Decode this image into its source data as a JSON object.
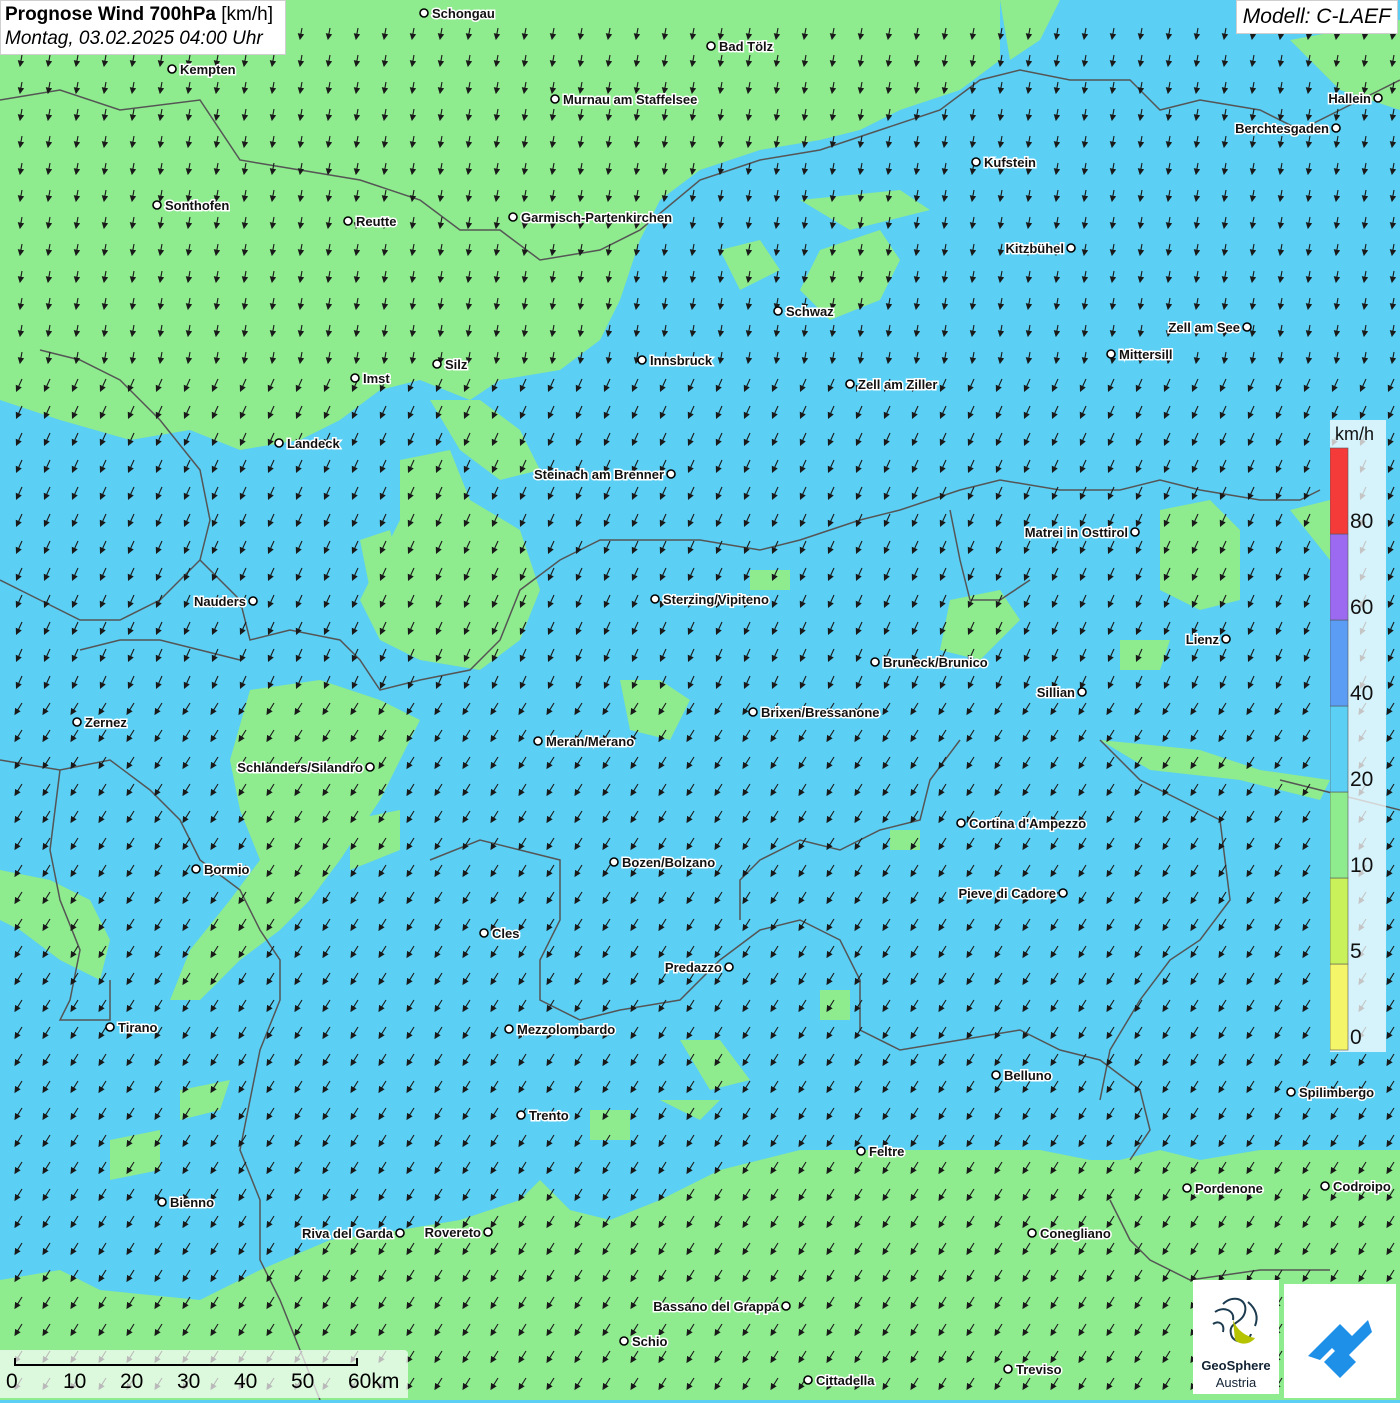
{
  "header": {
    "title_bold": "Prognose Wind 700hPa",
    "title_unit": " [km/h]",
    "subtitle": "Montag, 03.02.2025 04:00 Uhr"
  },
  "model_label": "Modell: C-LAEF",
  "legend": {
    "unit": "km/h",
    "bands": [
      {
        "from": 0,
        "to": 5,
        "color": "#f5f56a"
      },
      {
        "from": 5,
        "to": 10,
        "color": "#c9f25a"
      },
      {
        "from": 10,
        "to": 20,
        "color": "#8eeb8e"
      },
      {
        "from": 20,
        "to": 40,
        "color": "#5bcff4"
      },
      {
        "from": 40,
        "to": 60,
        "color": "#5b9cf4"
      },
      {
        "from": 60,
        "to": 80,
        "color": "#9b6af0"
      },
      {
        "from": 80,
        "to": 100,
        "color": "#f53a3a"
      }
    ],
    "tick_labels": [
      "0",
      "5",
      "10",
      "20",
      "40",
      "60",
      "80"
    ]
  },
  "scale_bar": {
    "labels": [
      "0",
      "10",
      "20",
      "30",
      "40",
      "50",
      "60km"
    ]
  },
  "logos": {
    "geosphere_name": "GeoSphere",
    "geosphere_sub": "Austria"
  },
  "colors": {
    "wind_low": "#8eeb8e",
    "wind_mid": "#5bcff4",
    "arrow": "#1a1a1a",
    "border": "#555555"
  },
  "cities": [
    {
      "name": "Schongau"
    },
    {
      "name": "Bad Tölz"
    },
    {
      "name": "Kempten"
    },
    {
      "name": "Murnau am Staffelsee"
    },
    {
      "name": "Hallein"
    },
    {
      "name": "Berchtesgaden"
    },
    {
      "name": "Kufstein"
    },
    {
      "name": "Sonthofen"
    },
    {
      "name": "Reutte"
    },
    {
      "name": "Garmisch-Partenkirchen"
    },
    {
      "name": "Kitzbühel"
    },
    {
      "name": "Schwaz"
    },
    {
      "name": "Zell am See"
    },
    {
      "name": "Mittersill"
    },
    {
      "name": "Innsbruck"
    },
    {
      "name": "Silz"
    },
    {
      "name": "Imst"
    },
    {
      "name": "Zell am Ziller"
    },
    {
      "name": "Landeck"
    },
    {
      "name": "Steinach am Brenner"
    },
    {
      "name": "Matrei in Osttirol"
    },
    {
      "name": "Nauders"
    },
    {
      "name": "Sterzing/Vipiteno"
    },
    {
      "name": "Lienz"
    },
    {
      "name": "Bruneck/Brunico"
    },
    {
      "name": "Sillian"
    },
    {
      "name": "Zernez"
    },
    {
      "name": "Brixen/Bressanone"
    },
    {
      "name": "Meran/Merano"
    },
    {
      "name": "Schlanders/Silandro"
    },
    {
      "name": "Cortina d'Ampezzo"
    },
    {
      "name": "Bozen/Bolzano"
    },
    {
      "name": "Bormio"
    },
    {
      "name": "Pieve di Cadore"
    },
    {
      "name": "Cles"
    },
    {
      "name": "Predazzo"
    },
    {
      "name": "Tirano"
    },
    {
      "name": "Mezzolombardo"
    },
    {
      "name": "Belluno"
    },
    {
      "name": "Spilimbergo"
    },
    {
      "name": "Trento"
    },
    {
      "name": "Feltre"
    },
    {
      "name": "Pordenone"
    },
    {
      "name": "Codroipo"
    },
    {
      "name": "Bienno"
    },
    {
      "name": "Riva del Garda"
    },
    {
      "name": "Rovereto"
    },
    {
      "name": "Conegliano"
    },
    {
      "name": "Bassano del Grappa"
    },
    {
      "name": "Schio"
    },
    {
      "name": "Treviso"
    },
    {
      "name": "Cittadella"
    }
  ]
}
